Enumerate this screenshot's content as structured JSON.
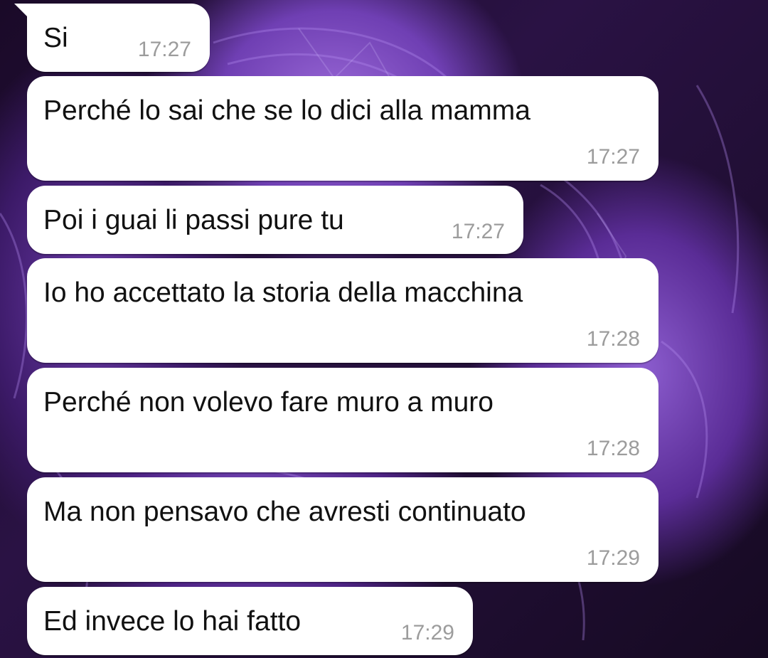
{
  "chat": {
    "messages": [
      {
        "text": "Si",
        "time": "17:27"
      },
      {
        "text": "Perché lo sai che se lo dici alla mamma",
        "time": "17:27"
      },
      {
        "text": "Poi i guai li passi pure tu",
        "time": "17:27"
      },
      {
        "text": "Io ho accettato la storia della macchina",
        "time": "17:28"
      },
      {
        "text": "Perché non volevo fare muro a muro",
        "time": "17:28"
      },
      {
        "text": "Ma non pensavo che avresti continuato",
        "time": "17:29"
      },
      {
        "text": "Ed invece lo hai fatto",
        "time": "17:29"
      }
    ]
  },
  "colors": {
    "bubble_background": "#ffffff",
    "message_text": "#111111",
    "timestamp_text": "#9c9c9c",
    "wallpaper_accent": "#8d5ed0"
  }
}
